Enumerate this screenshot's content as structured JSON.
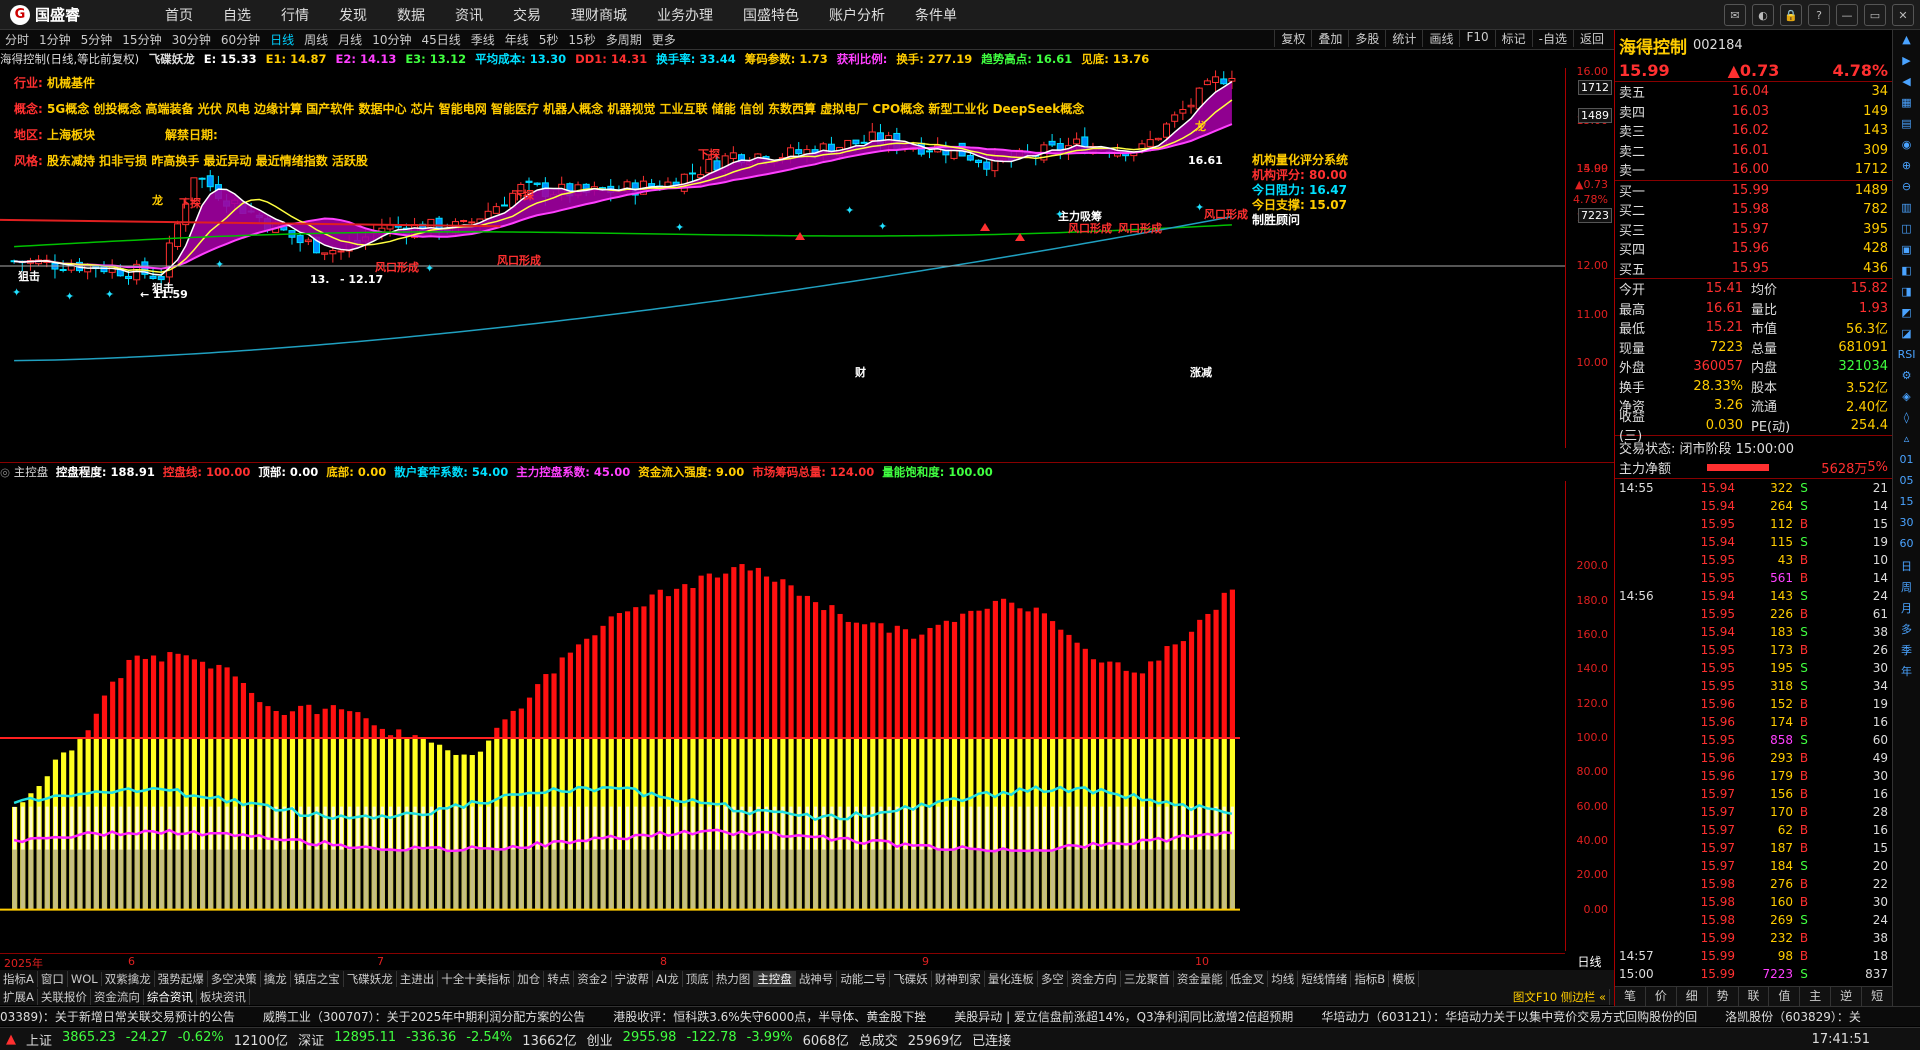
{
  "app": {
    "logo_text": "国盛睿"
  },
  "menu": [
    "首页",
    "自选",
    "行情",
    "发现",
    "数据",
    "资讯",
    "交易",
    "理财商城",
    "业务办理",
    "国盛特色",
    "账户分析",
    "条件单"
  ],
  "window_controls": [
    "消息",
    "皮肤",
    "锁",
    "帮助",
    "最小化",
    "还原",
    "关闭"
  ],
  "periods": [
    "分时",
    "1分钟",
    "5分钟",
    "15分钟",
    "30分钟",
    "60分钟",
    "日线",
    "周线",
    "月线",
    "10分钟",
    "45日线",
    "季线",
    "年线",
    "5秒",
    "15秒",
    "多周期",
    "更多"
  ],
  "active_period": "日线",
  "chart_buttons": [
    "复权",
    "叠加",
    "多股",
    "统计",
    "画线",
    "F10",
    "标记",
    "-自选",
    "返回"
  ],
  "ind1": {
    "name": "海得控制(日线,等比前复权)",
    "items": [
      {
        "t": "飞碟妖龙",
        "c": "#ddd"
      },
      {
        "t": "E: 15.33",
        "c": "#fff"
      },
      {
        "t": "E1: 14.87",
        "c": "#ffcc00"
      },
      {
        "t": "E2: 14.13",
        "c": "#ff40ff"
      },
      {
        "t": "E3: 13.12",
        "c": "#40ff40"
      },
      {
        "t": "平均成本: 13.30",
        "c": "#00e0ff"
      },
      {
        "t": "DD1: 14.31",
        "c": "#ff3030"
      },
      {
        "t": "换手率: 33.44",
        "c": "#00e0ff"
      },
      {
        "t": "筹码参数: 1.73",
        "c": "#ffcc00"
      },
      {
        "t": "获利比例:",
        "c": "#ff40ff"
      },
      {
        "t": "换手: 277.19",
        "c": "#ffcc00"
      },
      {
        "t": "趋势高点: 16.61",
        "c": "#40ff40"
      },
      {
        "t": "见底: 13.76",
        "c": "#ffcc00"
      }
    ]
  },
  "info": {
    "industry_label": "行业:",
    "industry": "机械基件",
    "concept_label": "概念:",
    "concepts": "5G概念 创投概念 高端装备 光伏 风电 边缘计算 国产软件 数据中心 芯片 智能电网 智能医疗 机器人概念 机器视觉 工业互联 储能 信创 东数西算 虚拟电厂 CPO概念 新型工业化 DeepSeek概念",
    "region_label": "地区:",
    "region": "上海板块",
    "unlock_label": "解禁日期:",
    "style_label": "风格:",
    "styles": "股东减持 扣非亏损 昨高换手 最近异动 最近情绪指数 活跃股"
  },
  "quant": {
    "title": "机构量化评分系统",
    "score_label": "机构评分:",
    "score": "80.00",
    "resist_label": "今日阻力:",
    "resist": "16.47",
    "support_label": "今日支撑:",
    "support": "15.07",
    "tag": "制胜顾问"
  },
  "price_axis": [
    "16.00",
    "15.00",
    "14.00",
    "13.00",
    "12.00",
    "11.00",
    "10.00"
  ],
  "price_axis_boxes": [
    "1712",
    "1489",
    "7223"
  ],
  "price_axis_mark": [
    "15.99",
    "▲0.73",
    "4.78%"
  ],
  "chart_labels": {
    "high": "16.61",
    "low1": "11.59",
    "low2_left": "13.",
    "low2_right": "12.17",
    "cai": "财",
    "zhang": "涨减",
    "zhujia": "主力吸筹",
    "fk": "风口形成",
    "xt": "下探",
    "lj": "狙击",
    "long": "龙"
  },
  "sub_title": "主控盘",
  "ind2": [
    {
      "t": "控盘程度: 188.91",
      "c": "#fff"
    },
    {
      "t": "控盘线: 100.00",
      "c": "#ff3030"
    },
    {
      "t": "顶部: 0.00",
      "c": "#fff"
    },
    {
      "t": "底部: 0.00",
      "c": "#ffcc00"
    },
    {
      "t": "散户套牢系数: 54.00",
      "c": "#00e0ff"
    },
    {
      "t": "主力控盘系数: 45.00",
      "c": "#ff40ff"
    },
    {
      "t": "资金流入强度: 9.00",
      "c": "#ffcc00"
    },
    {
      "t": "市场筹码总量: 124.00",
      "c": "#ff3030"
    },
    {
      "t": "量能饱和度: 100.00",
      "c": "#40ff40"
    }
  ],
  "sub_axis": [
    "200.0",
    "180.0",
    "160.0",
    "140.0",
    "120.0",
    "100.0",
    "80.00",
    "60.00",
    "40.00",
    "20.00",
    "0.00"
  ],
  "date_axis": [
    "2025年",
    "6",
    "7",
    "8",
    "9",
    "10"
  ],
  "period_label": "日线",
  "tabs1": [
    "指标A",
    "窗口",
    "WOL",
    "双紫擒龙",
    "强势起爆",
    "多空决策",
    "擒龙",
    "镇店之宝",
    "飞碟妖龙",
    "主进出",
    "十全十美指标",
    "加仓",
    "转点",
    "资金2",
    "宁波帮",
    "AI龙",
    "顶底",
    "热力图",
    "主控盘",
    "战神号",
    "动能二号",
    "飞碟妖",
    "财神到家",
    "量化连板",
    "多空",
    "资金方向",
    "三龙聚首",
    "资金量能",
    "低金叉",
    "均线",
    "短线情绪",
    "指标B",
    "模板"
  ],
  "tabs1_active": "主控盘",
  "tabs2": [
    "扩展A",
    "关联报价",
    "资金流向",
    "综合资讯",
    "板块资讯"
  ],
  "tabs2_active": "综合资讯",
  "tabs2_right": "图文F10 侧边栏 «",
  "ticker": [
    "03389)：关于新增日常关联交易预计的公告",
    "威腾工业（300707）：关于2025年中期利润分配方案的公告",
    "港股收评：恒科跌3.6%失守6000点，半导体、黄金股下挫",
    "美股异动 | 爱立信盘前涨超14%，Q3净利润同比激增2倍超预期",
    "华培动力（603121）：华培动力关于以集中竞价交易方式回购股份的回",
    "洛凯股份（603829）：关"
  ],
  "status": [
    {
      "t": "上证",
      "c": "#ddd"
    },
    {
      "t": "3865.23",
      "c": "#40ff40"
    },
    {
      "t": "-24.27",
      "c": "#40ff40"
    },
    {
      "t": "-0.62%",
      "c": "#40ff40"
    },
    {
      "t": "12100亿",
      "c": "#ddd"
    },
    {
      "t": "深证",
      "c": "#ddd"
    },
    {
      "t": "12895.11",
      "c": "#40ff40"
    },
    {
      "t": "-336.36",
      "c": "#40ff40"
    },
    {
      "t": "-2.54%",
      "c": "#40ff40"
    },
    {
      "t": "13662亿",
      "c": "#ddd"
    },
    {
      "t": "创业",
      "c": "#ddd"
    },
    {
      "t": "2955.98",
      "c": "#40ff40"
    },
    {
      "t": "-122.78",
      "c": "#40ff40"
    },
    {
      "t": "-3.99%",
      "c": "#40ff40"
    },
    {
      "t": "6068亿",
      "c": "#ddd"
    },
    {
      "t": "总成交",
      "c": "#ddd"
    },
    {
      "t": "25969亿",
      "c": "#ddd"
    },
    {
      "t": "已连接",
      "c": "#ddd"
    }
  ],
  "clock": "17:41:51",
  "right": {
    "name": "海得控制",
    "code": "002184",
    "price": "15.99",
    "change": "▲0.73",
    "pct": "4.78%",
    "asks": [
      [
        "卖五",
        "16.04",
        "34"
      ],
      [
        "卖四",
        "16.03",
        "149"
      ],
      [
        "卖三",
        "16.02",
        "143"
      ],
      [
        "卖二",
        "16.01",
        "309"
      ],
      [
        "卖一",
        "16.00",
        "1712"
      ]
    ],
    "bids": [
      [
        "买一",
        "15.99",
        "1489"
      ],
      [
        "买二",
        "15.98",
        "782"
      ],
      [
        "买三",
        "15.97",
        "395"
      ],
      [
        "买四",
        "15.96",
        "428"
      ],
      [
        "买五",
        "15.95",
        "436"
      ]
    ],
    "stats": [
      [
        "今开",
        "15.41",
        "均价",
        "15.82"
      ],
      [
        "最高",
        "16.61",
        "量比",
        "1.93"
      ],
      [
        "最低",
        "15.21",
        "市值",
        "56.3亿"
      ],
      [
        "现量",
        "7223",
        "总量",
        "681091"
      ],
      [
        "外盘",
        "360057",
        "内盘",
        "321034"
      ],
      [
        "换手",
        "28.33%",
        "股本",
        "3.52亿"
      ],
      [
        "净资",
        "3.26",
        "流通",
        "2.40亿"
      ],
      [
        "收益(三)",
        "0.030",
        "PE(动)",
        "254.4"
      ]
    ],
    "trade_state": "交易状态: 闭市阶段 15:00:00",
    "mainnet_label": "主力净额",
    "mainnet_value": "5628万",
    "mainnet_pct": "5%",
    "ticks": [
      [
        "14:55",
        "15.94",
        "322",
        "S",
        "21"
      ],
      [
        "",
        "15.94",
        "264",
        "S",
        "14"
      ],
      [
        "",
        "15.95",
        "112",
        "B",
        "15"
      ],
      [
        "",
        "15.94",
        "115",
        "S",
        "19"
      ],
      [
        "",
        "15.95",
        "43",
        "B",
        "10"
      ],
      [
        "",
        "15.95",
        "561",
        "B",
        "14"
      ],
      [
        "14:56",
        "15.94",
        "143",
        "S",
        "24"
      ],
      [
        "",
        "15.95",
        "226",
        "B",
        "61"
      ],
      [
        "",
        "15.94",
        "183",
        "S",
        "38"
      ],
      [
        "",
        "15.95",
        "173",
        "B",
        "26"
      ],
      [
        "",
        "15.95",
        "195",
        "S",
        "30"
      ],
      [
        "",
        "15.95",
        "318",
        "S",
        "34"
      ],
      [
        "",
        "15.96",
        "152",
        "B",
        "19"
      ],
      [
        "",
        "15.96",
        "174",
        "B",
        "16"
      ],
      [
        "",
        "15.95",
        "858",
        "S",
        "60"
      ],
      [
        "",
        "15.96",
        "293",
        "B",
        "49"
      ],
      [
        "",
        "15.96",
        "179",
        "B",
        "30"
      ],
      [
        "",
        "15.97",
        "156",
        "B",
        "16"
      ],
      [
        "",
        "15.97",
        "170",
        "B",
        "28"
      ],
      [
        "",
        "15.97",
        "62",
        "B",
        "16"
      ],
      [
        "",
        "15.97",
        "187",
        "B",
        "15"
      ],
      [
        "",
        "15.97",
        "184",
        "S",
        "20"
      ],
      [
        "",
        "15.98",
        "276",
        "B",
        "22"
      ],
      [
        "",
        "15.98",
        "160",
        "B",
        "30"
      ],
      [
        "",
        "15.98",
        "269",
        "S",
        "24"
      ],
      [
        "",
        "15.99",
        "232",
        "B",
        "38"
      ],
      [
        "14:57",
        "15.99",
        "98",
        "B",
        "18"
      ],
      [
        "15:00",
        "15.99",
        "7223",
        "S",
        "837"
      ]
    ],
    "bottom_tabs": [
      "笔",
      "价",
      "细",
      "势",
      "联",
      "值",
      "主",
      "逆",
      "短"
    ]
  },
  "side_icons": [
    "▲",
    "▶",
    "◀",
    "▦",
    "▤",
    "◉",
    "⊕",
    "⊖",
    "▥",
    "◫",
    "▣",
    "◧",
    "◨",
    "◩",
    "◪",
    "RSI",
    "⚙",
    "◈",
    "◊",
    "▵",
    "01",
    "05",
    "15",
    "30",
    "60",
    "日",
    "周",
    "月",
    "多",
    "季",
    "年"
  ]
}
